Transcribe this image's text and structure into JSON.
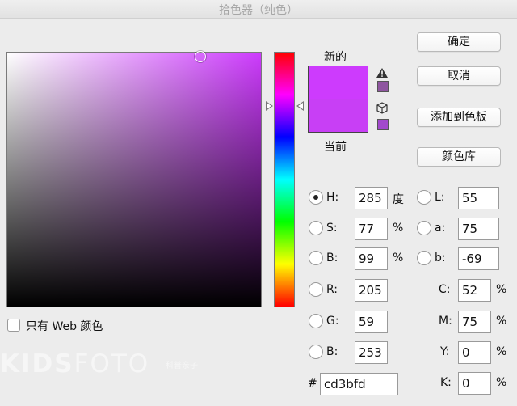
{
  "window": {
    "title": "拾色器（纯色）"
  },
  "swatches": {
    "new_label": "新的",
    "current_label": "当前",
    "new_color": "#cd3bfd",
    "current_color": "#c83ff5"
  },
  "icons": {
    "gamut_warning": "warning-triangle-icon",
    "web_safe": "cube-icon",
    "gamut_swatch_color": "#8f56a0",
    "web_swatch_color": "#a249cc"
  },
  "buttons": {
    "ok": "确定",
    "cancel": "取消",
    "add_to_swatches": "添加到色板",
    "color_libraries": "颜色库"
  },
  "hsb": [
    {
      "label": "H:",
      "value": "285",
      "unit": "度",
      "selected": true
    },
    {
      "label": "S:",
      "value": "77",
      "unit": "%",
      "selected": false
    },
    {
      "label": "B:",
      "value": "99",
      "unit": "%",
      "selected": false
    }
  ],
  "lab": [
    {
      "label": "L:",
      "value": "55"
    },
    {
      "label": "a:",
      "value": "75"
    },
    {
      "label": "b:",
      "value": "-69"
    }
  ],
  "rgb": [
    {
      "label": "R:",
      "value": "205"
    },
    {
      "label": "G:",
      "value": "59"
    },
    {
      "label": "B:",
      "value": "253"
    }
  ],
  "cmyk": [
    {
      "label": "C:",
      "value": "52",
      "unit": "%"
    },
    {
      "label": "M:",
      "value": "75",
      "unit": "%"
    },
    {
      "label": "Y:",
      "value": "0",
      "unit": "%"
    },
    {
      "label": "K:",
      "value": "0",
      "unit": "%"
    }
  ],
  "hex": {
    "label": "#",
    "value": "cd3bfd"
  },
  "web_only": {
    "label": "只有 Web 颜色",
    "checked": false
  },
  "watermark": {
    "text": "KIDSFOTO",
    "sub": "科普亲子"
  }
}
